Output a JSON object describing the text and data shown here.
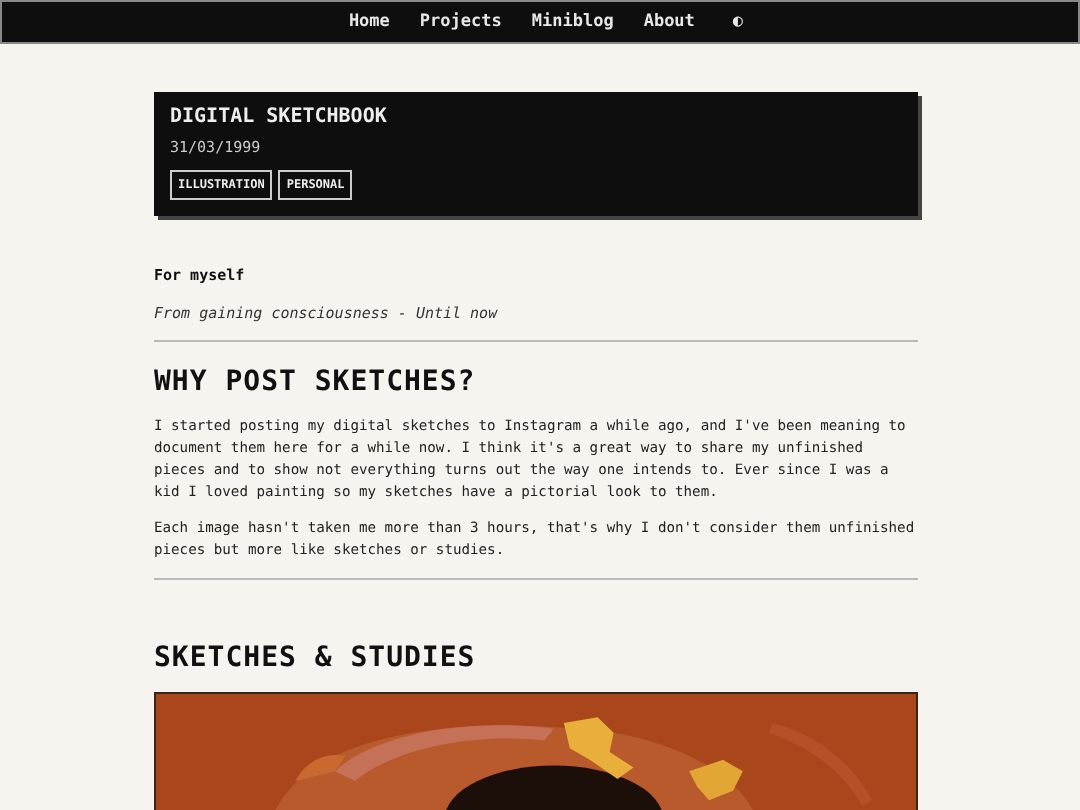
{
  "nav": {
    "items": [
      "Home",
      "Projects",
      "Miniblog",
      "About"
    ],
    "theme_toggle": "◐"
  },
  "header": {
    "title": "DIGITAL SKETCHBOOK",
    "date": "31/03/1999",
    "tags": [
      "ILLUSTRATION",
      "PERSONAL"
    ]
  },
  "meta": {
    "audience": "For myself",
    "period": "From gaining consciousness - Until now"
  },
  "sections": [
    {
      "heading": "WHY POST SKETCHES?",
      "paragraphs": [
        "I started posting my digital sketches to Instagram a while ago, and I've been meaning to document them here for a while now. I think it's a great way to share my unfinished pieces and to show not everything turns out the way one intends to. Ever since I was a kid I loved painting so my sketches have a pictorial look to them.",
        "Each image hasn't taken me more than 3 hours, that's why I don't consider them unfinished pieces but more like sketches or studies."
      ]
    },
    {
      "heading": "SKETCHES & STUDIES"
    }
  ]
}
